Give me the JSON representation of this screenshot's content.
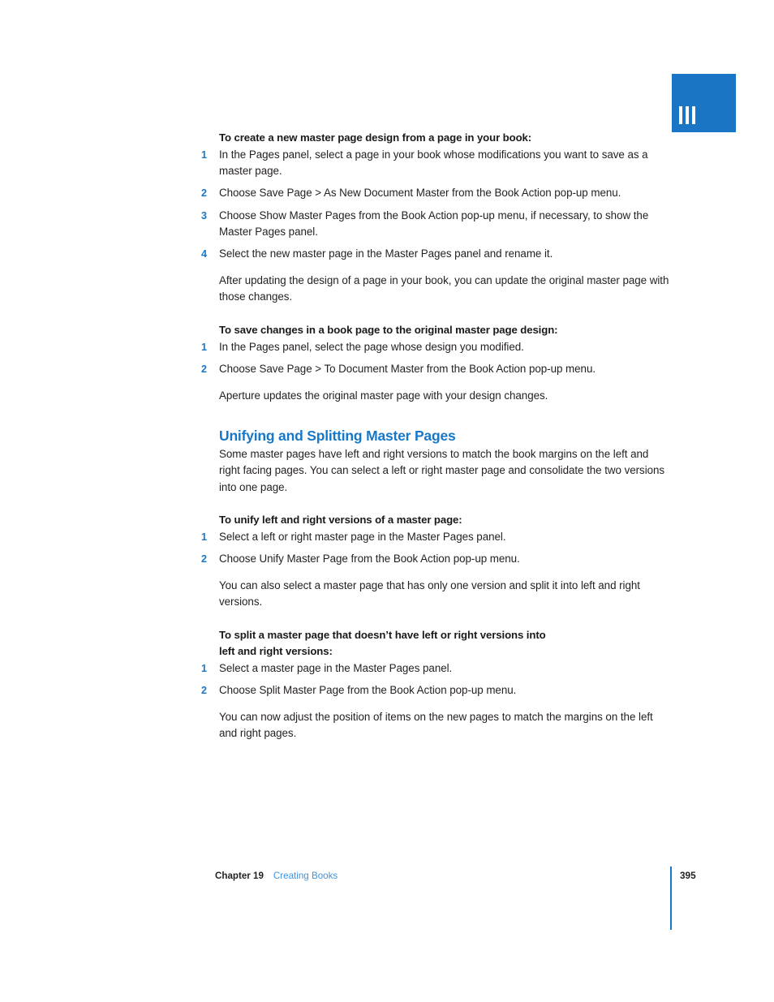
{
  "chapter_tab": {
    "numeral": "III",
    "bar_count": 3,
    "color": "#1a76c4"
  },
  "colors": {
    "accent_blue": "#1878c8",
    "link_blue": "#3f93dd",
    "body_text": "#231f20"
  },
  "sections": [
    {
      "id": "create-new-master",
      "heading": "To create a new master page design from a page in your book:",
      "steps": [
        {
          "num": "1",
          "text": "In the Pages panel, select a page in your book whose modifications you want to save as a master page."
        },
        {
          "num": "2",
          "text": "Choose Save Page > As New Document Master from the Book Action pop-up menu."
        },
        {
          "num": "3",
          "text": "Choose Show Master Pages from the Book Action pop-up menu, if necessary, to show the Master Pages panel."
        },
        {
          "num": "4",
          "text": "Select the new master page in the Master Pages panel and rename it."
        }
      ],
      "note": "After updating the design of a page in your book, you can update the original master page with those changes."
    },
    {
      "id": "save-changes-to-master",
      "heading": "To save changes in a book page to the original master page design:",
      "steps": [
        {
          "num": "1",
          "text": "In the Pages panel, select the page whose design you modified."
        },
        {
          "num": "2",
          "text": "Choose Save Page > To Document Master from the Book Action pop-up menu."
        }
      ],
      "note": "Aperture updates the original master page with your design changes."
    }
  ],
  "topic": {
    "title": "Unifying and Splitting Master Pages",
    "intro": "Some master pages have left and right versions to match the book margins on the left and right facing pages. You can select a left or right master page and consolidate the two versions into one page.",
    "unify": {
      "heading": "To unify left and right versions of a master page:",
      "steps": [
        {
          "num": "1",
          "text": "Select a left or right master page in the Master Pages panel."
        },
        {
          "num": "2",
          "text": "Choose Unify Master Page from the Book Action pop-up menu."
        }
      ],
      "note": "You can also select a master page that has only one version and split it into left and right versions."
    },
    "split": {
      "heading_line1": "To split a master page that doesn’t have left or right versions into",
      "heading_line2": "left and right versions:",
      "steps": [
        {
          "num": "1",
          "text": "Select a master page in the Master Pages panel."
        },
        {
          "num": "2",
          "text": "Choose Split Master Page from the Book Action pop-up menu."
        }
      ],
      "note": "You can now adjust the position of items on the new pages to match the margins on the left and right pages."
    }
  },
  "footer": {
    "chapter_label": "Chapter 19",
    "chapter_title": "Creating Books",
    "page_number": "395"
  }
}
